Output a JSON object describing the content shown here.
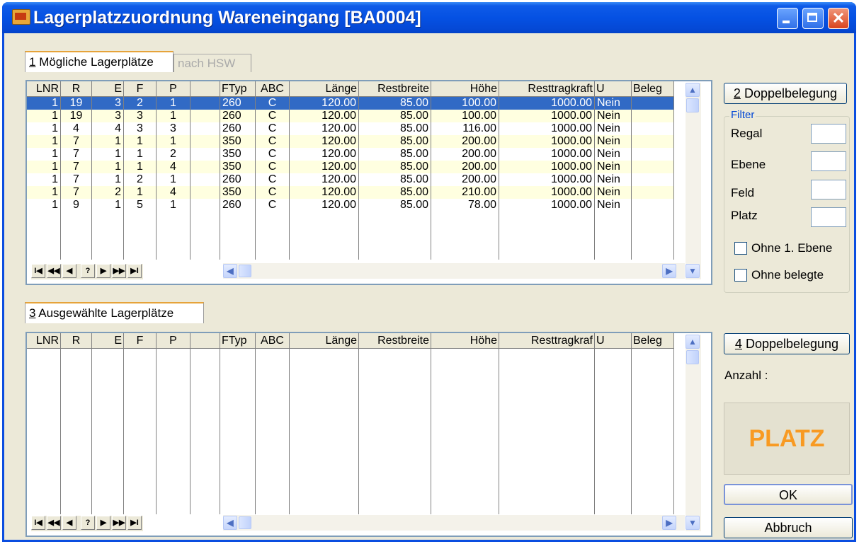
{
  "window": {
    "title": "Lagerplatzzuordnung Wareneingang [BA0004]"
  },
  "tabs_top": [
    {
      "hotkey": "1",
      "label": " Mögliche Lagerplätze"
    },
    {
      "label": "nach HSW"
    }
  ],
  "tab_bottom": {
    "hotkey": "3",
    "label": " Ausgewählte Lagerplätze"
  },
  "columns": [
    "LNR",
    "R",
    "E",
    "F",
    "P",
    "",
    "FTyp",
    "ABC",
    "Länge",
    "Restbreite",
    "Höhe",
    "Resttragkraft",
    "U",
    "Beleg"
  ],
  "columns_bottom": [
    "LNR",
    "R",
    "E",
    "F",
    "P",
    "",
    "FTyp",
    "ABC",
    "Länge",
    "Restbreite",
    "Höhe",
    "Resttragkraf",
    "U",
    "Beleg"
  ],
  "rows": [
    [
      "1",
      "19",
      "3",
      "2",
      "1",
      "",
      "260",
      "C",
      "120.00",
      "85.00",
      "100.00",
      "1000.00",
      "Nein",
      ""
    ],
    [
      "1",
      "19",
      "3",
      "3",
      "1",
      "",
      "260",
      "C",
      "120.00",
      "85.00",
      "100.00",
      "1000.00",
      "Nein",
      ""
    ],
    [
      "1",
      "4",
      "4",
      "3",
      "3",
      "",
      "260",
      "C",
      "120.00",
      "85.00",
      "116.00",
      "1000.00",
      "Nein",
      ""
    ],
    [
      "1",
      "7",
      "1",
      "1",
      "1",
      "",
      "350",
      "C",
      "120.00",
      "85.00",
      "200.00",
      "1000.00",
      "Nein",
      ""
    ],
    [
      "1",
      "7",
      "1",
      "1",
      "2",
      "",
      "350",
      "C",
      "120.00",
      "85.00",
      "200.00",
      "1000.00",
      "Nein",
      ""
    ],
    [
      "1",
      "7",
      "1",
      "1",
      "4",
      "",
      "350",
      "C",
      "120.00",
      "85.00",
      "200.00",
      "1000.00",
      "Nein",
      ""
    ],
    [
      "1",
      "7",
      "1",
      "2",
      "1",
      "",
      "260",
      "C",
      "120.00",
      "85.00",
      "200.00",
      "1000.00",
      "Nein",
      ""
    ],
    [
      "1",
      "7",
      "2",
      "1",
      "4",
      "",
      "350",
      "C",
      "120.00",
      "85.00",
      "210.00",
      "1000.00",
      "Nein",
      ""
    ],
    [
      "1",
      "9",
      "1",
      "5",
      "1",
      "",
      "260",
      "C",
      "120.00",
      "85.00",
      "78.00",
      "1000.00",
      "Nein",
      ""
    ]
  ],
  "selected_row": 0,
  "nav_buttons": [
    {
      "glyph": "I◀",
      "name": "nav-first-button"
    },
    {
      "glyph": "◀◀",
      "name": "nav-prev-page-button"
    },
    {
      "glyph": "◀",
      "name": "nav-prev-button"
    },
    {
      "glyph": "?",
      "name": "nav-search-button"
    },
    {
      "glyph": "▶",
      "name": "nav-next-button"
    },
    {
      "glyph": "▶▶",
      "name": "nav-next-page-button"
    },
    {
      "glyph": "▶I",
      "name": "nav-last-button"
    }
  ],
  "buttons": {
    "doppel1_hotkey": "2",
    "doppel1_label": " Doppelbelegung",
    "doppel2_hotkey": "4",
    "doppel2_label": " Doppelbelegung",
    "ok": "OK",
    "cancel": "Abbruch"
  },
  "filter": {
    "title": "Filter",
    "regal": "Regal",
    "ebene": "Ebene",
    "feld": "Feld",
    "platz": "Platz",
    "ohne_ebene": "Ohne 1. Ebene",
    "ohne_belegte": "Ohne belegte"
  },
  "anzahl_label": "Anzahl :",
  "platz_label": "PLATZ",
  "colors": {
    "selection": "#316ac5",
    "alt_row": "#ffffe0",
    "platz_text": "#f89a22",
    "title_bar": "#0551e3"
  }
}
